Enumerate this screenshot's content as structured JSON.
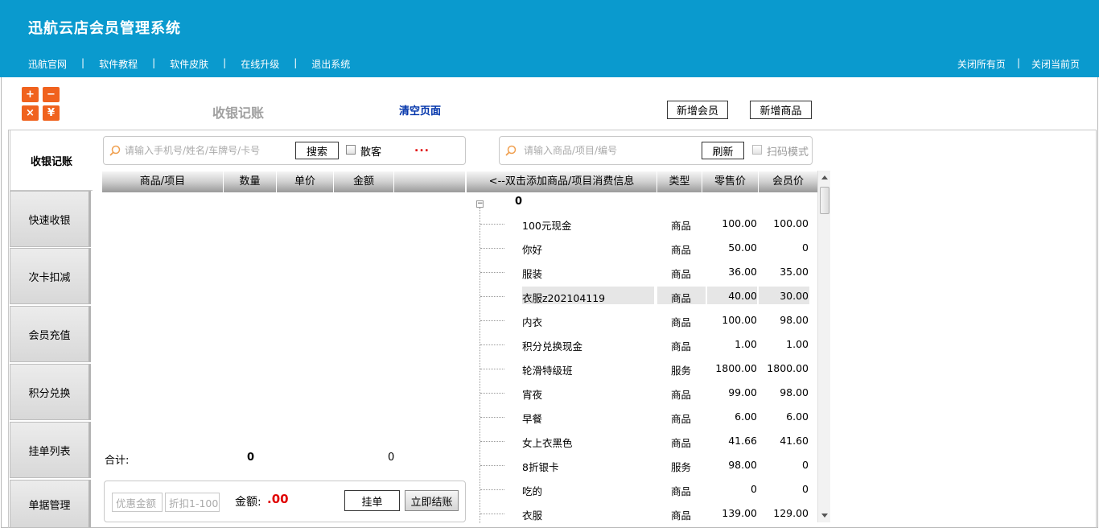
{
  "header": {
    "title": "迅航云店会员管理系统",
    "nav_left": [
      "迅航官网",
      "软件教程",
      "软件皮肤",
      "在线升级",
      "退出系统"
    ],
    "nav_right": [
      "关闭所有页",
      "关闭当前页"
    ],
    "separator": "|"
  },
  "toolbar": {
    "calc_icons": [
      "+",
      "−",
      "×",
      "¥"
    ],
    "page_title": "收银记账",
    "clear_page": "清空页面",
    "add_member": "新增会员",
    "add_product": "新增商品"
  },
  "tabs": [
    "收银记账",
    "快速收银",
    "次卡扣减",
    "会员充值",
    "积分兑换",
    "挂单列表",
    "单据管理"
  ],
  "member_search": {
    "placeholder": "请输入手机号/姓名/车牌号/卡号",
    "search_button": "搜索",
    "walk_in_label": "散客",
    "dots": "..."
  },
  "product_search": {
    "placeholder": "请输入商品/项目/编号",
    "refresh_button": "刷新",
    "scan_mode_label": "扫码模式"
  },
  "cart": {
    "columns": [
      "商品/项目",
      "数量",
      "单价",
      "金额"
    ],
    "total_label": "合计:",
    "total_qty": "0",
    "total_amount": "0"
  },
  "checkout": {
    "discount_amount_placeholder": "优惠金额",
    "discount_rate_placeholder": "折扣1-100",
    "amount_label": "金额:",
    "amount_value": ".00",
    "hold_button": "挂单",
    "checkout_button": "立即结账"
  },
  "products": {
    "columns": [
      "<--双击添加商品/项目消费信息",
      "类型",
      "零售价",
      "会员价"
    ],
    "group_label": "0",
    "rows": [
      {
        "name": "100元现金",
        "type": "商品",
        "retail": "100.00",
        "member": "100.00"
      },
      {
        "name": "你好",
        "type": "商品",
        "retail": "50.00",
        "member": "0"
      },
      {
        "name": "服装",
        "type": "商品",
        "retail": "36.00",
        "member": "35.00"
      },
      {
        "name": "衣服z202104119",
        "type": "商品",
        "retail": "40.00",
        "member": "30.00"
      },
      {
        "name": "内衣",
        "type": "商品",
        "retail": "100.00",
        "member": "98.00"
      },
      {
        "name": "积分兑换现金",
        "type": "商品",
        "retail": "1.00",
        "member": "1.00"
      },
      {
        "name": "轮滑特级班",
        "type": "服务",
        "retail": "1800.00",
        "member": "1800.00"
      },
      {
        "name": "宵夜",
        "type": "商品",
        "retail": "99.00",
        "member": "98.00"
      },
      {
        "name": "早餐",
        "type": "商品",
        "retail": "6.00",
        "member": "6.00"
      },
      {
        "name": "女上衣黑色",
        "type": "商品",
        "retail": "41.66",
        "member": "41.60"
      },
      {
        "name": "8折银卡",
        "type": "服务",
        "retail": "98.00",
        "member": "0"
      },
      {
        "name": "吃的",
        "type": "商品",
        "retail": "0",
        "member": "0"
      },
      {
        "name": "衣服",
        "type": "商品",
        "retail": "139.00",
        "member": "129.00"
      }
    ]
  },
  "colors": {
    "header_bg": "#0a9ace",
    "calc_orange": "#f0621e",
    "clear_link": "#0033aa",
    "amount_red": "#e00000",
    "dots_red": "#e00000"
  }
}
